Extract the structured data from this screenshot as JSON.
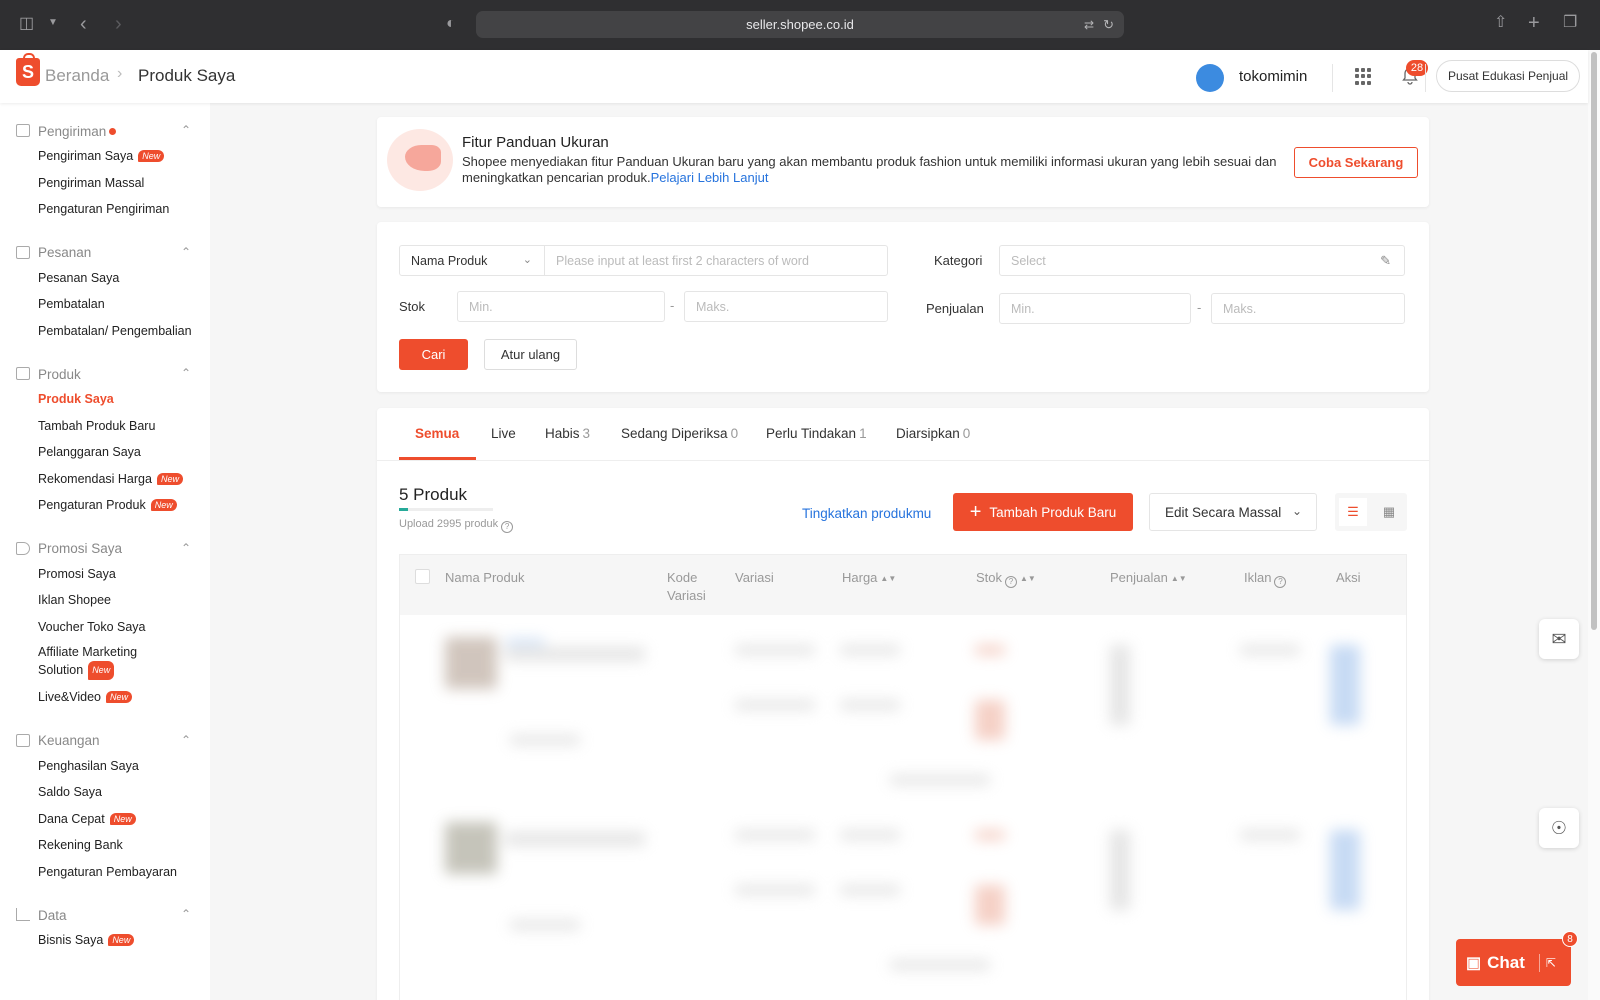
{
  "browser": {
    "url": "seller.shopee.co.id"
  },
  "header": {
    "logo_letter": "S",
    "breadcrumb_home": "Beranda",
    "breadcrumb_current": "Produk Saya",
    "username": "tokomimin",
    "notification_count": "28",
    "edu_button": "Pusat Edukasi Penjual"
  },
  "sidebar": {
    "new_tag": "New",
    "sections": [
      {
        "title": "Pengiriman",
        "items": [
          "Pengiriman Saya",
          "Pengiriman Massal",
          "Pengaturan Pengiriman"
        ]
      },
      {
        "title": "Pesanan",
        "items": [
          "Pesanan Saya",
          "Pembatalan",
          "Pembatalan/ Pengembalian"
        ]
      },
      {
        "title": "Produk",
        "items": [
          "Produk Saya",
          "Tambah Produk Baru",
          "Pelanggaran Saya",
          "Rekomendasi Harga",
          "Pengaturan Produk"
        ]
      },
      {
        "title": "Promosi Saya",
        "items": [
          "Promosi Saya",
          "Iklan Shopee",
          "Voucher Toko Saya",
          "Affiliate Marketing Solution",
          "Live&Video"
        ]
      },
      {
        "title": "Keuangan",
        "items": [
          "Penghasilan Saya",
          "Saldo Saya",
          "Dana Cepat",
          "Rekening Bank",
          "Pengaturan Pembayaran"
        ]
      },
      {
        "title": "Data",
        "items": [
          "Bisnis Saya"
        ]
      }
    ]
  },
  "banner": {
    "title": "Fitur Panduan Ukuran",
    "description": "Shopee menyediakan fitur Panduan Ukuran baru yang akan membantu produk fashion untuk memiliki informasi ukuran yang lebih sesuai dan meningkatkan pencarian produk.",
    "link": "Pelajari Lebih Lanjut",
    "button": "Coba Sekarang"
  },
  "filters": {
    "name_select": "Nama Produk",
    "name_placeholder": "Please input at least first 2 characters of word",
    "category_label": "Kategori",
    "category_placeholder": "Select",
    "stock_label": "Stok",
    "sales_label": "Penjualan",
    "min_placeholder": "Min.",
    "max_placeholder": "Maks.",
    "dash": "-",
    "search_button": "Cari",
    "reset_button": "Atur ulang"
  },
  "tabs": [
    {
      "label": "Semua",
      "count": ""
    },
    {
      "label": "Live",
      "count": ""
    },
    {
      "label": "Habis",
      "count": "3"
    },
    {
      "label": "Sedang Diperiksa",
      "count": "0"
    },
    {
      "label": "Perlu Tindakan",
      "count": "1"
    },
    {
      "label": "Diarsipkan",
      "count": "0"
    }
  ],
  "products": {
    "count_title": "5 Produk",
    "upload_text": "Upload 2995 produk",
    "upload_progress": 0.1,
    "upgrade_link": "Tingkatkan produkmu",
    "add_button": "Tambah Produk Baru",
    "mass_edit_button": "Edit Secara Massal"
  },
  "table": {
    "headers": {
      "name": "Nama Produk",
      "code_line1": "Kode",
      "code_line2": "Variasi",
      "variation": "Variasi",
      "price": "Harga",
      "stock": "Stok",
      "sales": "Penjualan",
      "ads": "Iklan",
      "action": "Aksi"
    }
  },
  "chat": {
    "label": "Chat",
    "badge": "8"
  },
  "colors": {
    "brand": "#ee4d2d",
    "link": "#2673dd"
  }
}
